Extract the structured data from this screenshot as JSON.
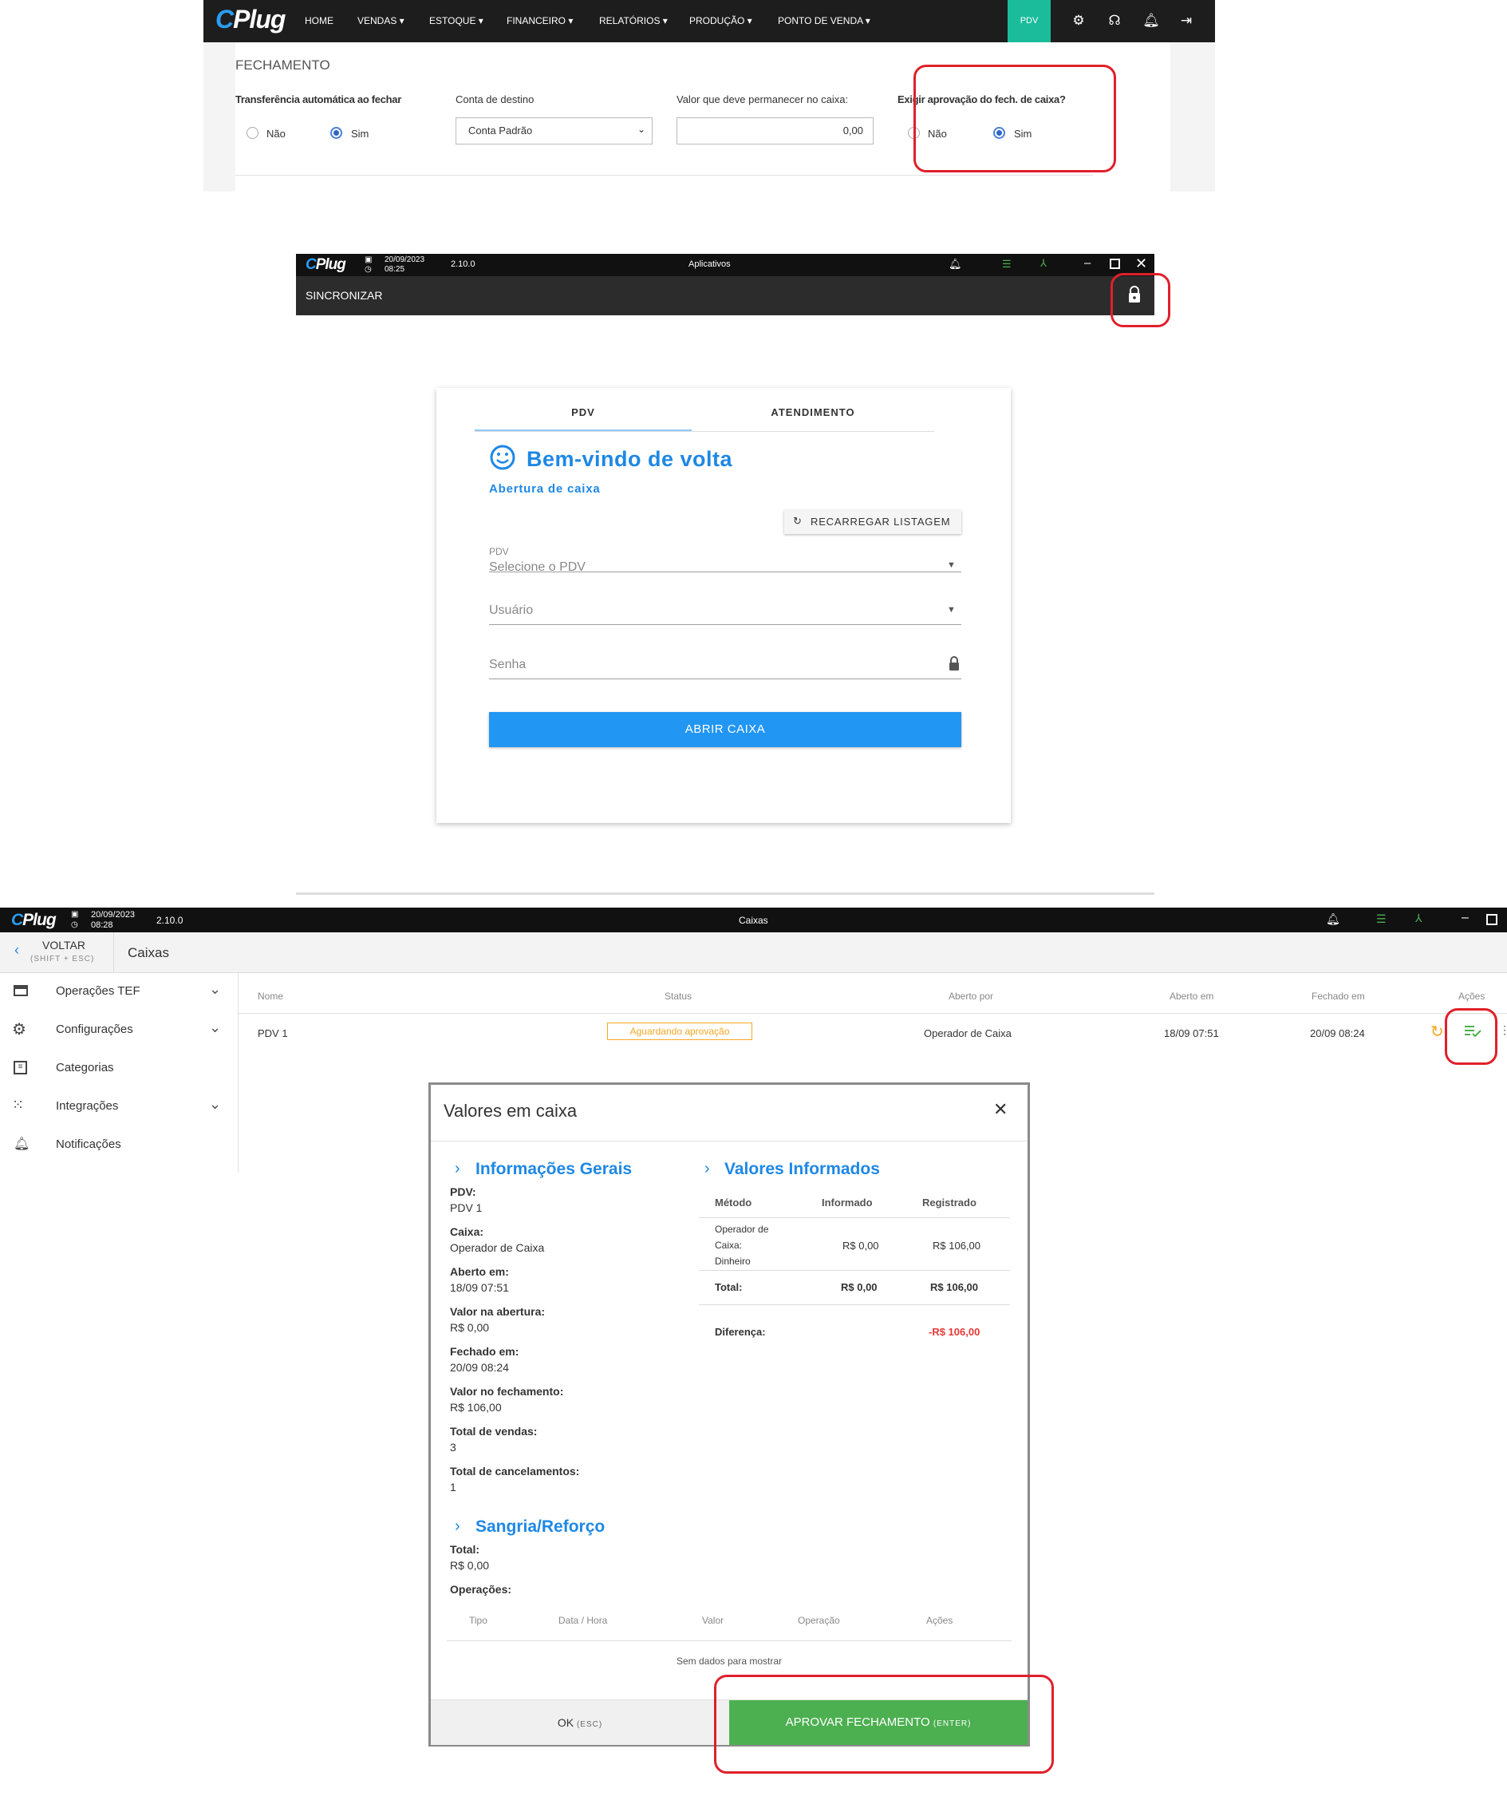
{
  "brand": {
    "logo_text": "CPlug"
  },
  "panel1": {
    "nav": {
      "items": [
        "HOME",
        "VENDAS ▾",
        "ESTOQUE ▾",
        "FINANCEIRO ▾",
        "RELATÓRIOS ▾",
        "PRODUÇÃO ▾",
        "PONTO DE VENDA ▾"
      ],
      "pdv_label": "PDV",
      "icons": [
        "gear-icon",
        "headset-icon",
        "bell-icon",
        "logout-icon"
      ]
    },
    "section_title": "FECHAMENTO",
    "transfer": {
      "label": "Transferência automática ao fechar",
      "opt_no": "Não",
      "opt_yes": "Sim",
      "selected": "Sim"
    },
    "destino": {
      "label": "Conta de destino",
      "value": "Conta Padrão"
    },
    "valor": {
      "label": "Valor que deve permanecer no caixa:",
      "value": "0,00"
    },
    "aprovacao": {
      "label": "Exigir aprovação do fech. de caixa?",
      "opt_no": "Não",
      "opt_yes": "Sim",
      "selected": "Sim"
    }
  },
  "panel2": {
    "titlebar": {
      "date": "20/09/2023",
      "time": "08:25",
      "version": "2.10.0",
      "center": "Aplicativos"
    },
    "sync_label": "SINCRONIZAR",
    "tabs": [
      "PDV",
      "ATENDIMENTO"
    ],
    "welcome": "Bem-vindo de volta",
    "subtitle": "Abertura de caixa",
    "reload_label": "RECARREGAR LISTAGEM",
    "pdv_field": {
      "label": "PDV",
      "placeholder": "Selecione o PDV"
    },
    "user_field": {
      "label": "Usuário"
    },
    "pass_field": {
      "label": "Senha"
    },
    "open_button": "ABRIR CAIXA"
  },
  "panel3": {
    "titlebar": {
      "date": "20/09/2023",
      "time": "08:28",
      "version": "2.10.0",
      "center": "Caixas"
    },
    "back": {
      "label": "VOLTAR",
      "hint": "(SHIFT + ESC)"
    },
    "page_title": "Caixas",
    "sidebar": [
      {
        "label": "Operações TEF",
        "icon": "card-icon",
        "expand": true
      },
      {
        "label": "Configurações",
        "icon": "gear-icon",
        "expand": true
      },
      {
        "label": "Categorias",
        "icon": "list-icon",
        "expand": false
      },
      {
        "label": "Integrações",
        "icon": "integrations-icon",
        "expand": true
      },
      {
        "label": "Notificações",
        "icon": "bell-icon",
        "expand": false
      }
    ],
    "table": {
      "headers": [
        "Nome",
        "Status",
        "Aberto por",
        "Aberto em",
        "Fechado em",
        "Ações"
      ],
      "row": {
        "nome": "PDV 1",
        "status": "Aguardando aprovação",
        "aberto_por": "Operador de Caixa",
        "aberto_em": "18/09 07:51",
        "fechado_em": "20/09 08:24"
      }
    },
    "modal": {
      "title": "Valores em caixa",
      "info_title": "Informações Gerais",
      "info": [
        {
          "k": "PDV:",
          "v": "PDV 1"
        },
        {
          "k": "Caixa:",
          "v": "Operador de Caixa"
        },
        {
          "k": "Aberto em:",
          "v": "18/09 07:51"
        },
        {
          "k": "Valor na abertura:",
          "v": "R$ 0,00"
        },
        {
          "k": "Fechado em:",
          "v": "20/09 08:24"
        },
        {
          "k": "Valor no fechamento:",
          "v": "R$ 106,00"
        },
        {
          "k": "Total de vendas:",
          "v": "3"
        },
        {
          "k": "Total de cancelamentos:",
          "v": "1"
        }
      ],
      "valores_title": "Valores Informados",
      "valores_headers": [
        "Método",
        "Informado",
        "Registrado"
      ],
      "valores_row": {
        "metodo_lines": [
          "Operador de",
          "Caixa:",
          "Dinheiro"
        ],
        "informado": "R$ 0,00",
        "registrado": "R$ 106,00"
      },
      "total": {
        "label": "Total:",
        "informado": "R$ 0,00",
        "registrado": "R$ 106,00"
      },
      "diferenca": {
        "label": "Diferença:",
        "value": "-R$ 106,00"
      },
      "sangria_title": "Sangria/Reforço",
      "sangria_total_label": "Total:",
      "sangria_total_value": "R$ 0,00",
      "operacoes_label": "Operações:",
      "op_headers": [
        "Tipo",
        "Data / Hora",
        "Valor",
        "Operação",
        "Ações"
      ],
      "empty": "Sem dados para mostrar",
      "ok_label": "OK",
      "ok_hint": "(ESC)",
      "approve_label": "APROVAR FECHAMENTO",
      "approve_hint": "(ENTER)"
    }
  },
  "colors": {
    "accent": "#1e88e5",
    "success": "#4caf50",
    "danger": "#e53935",
    "warning": "#f5a623",
    "highlight": "#e0202a"
  }
}
